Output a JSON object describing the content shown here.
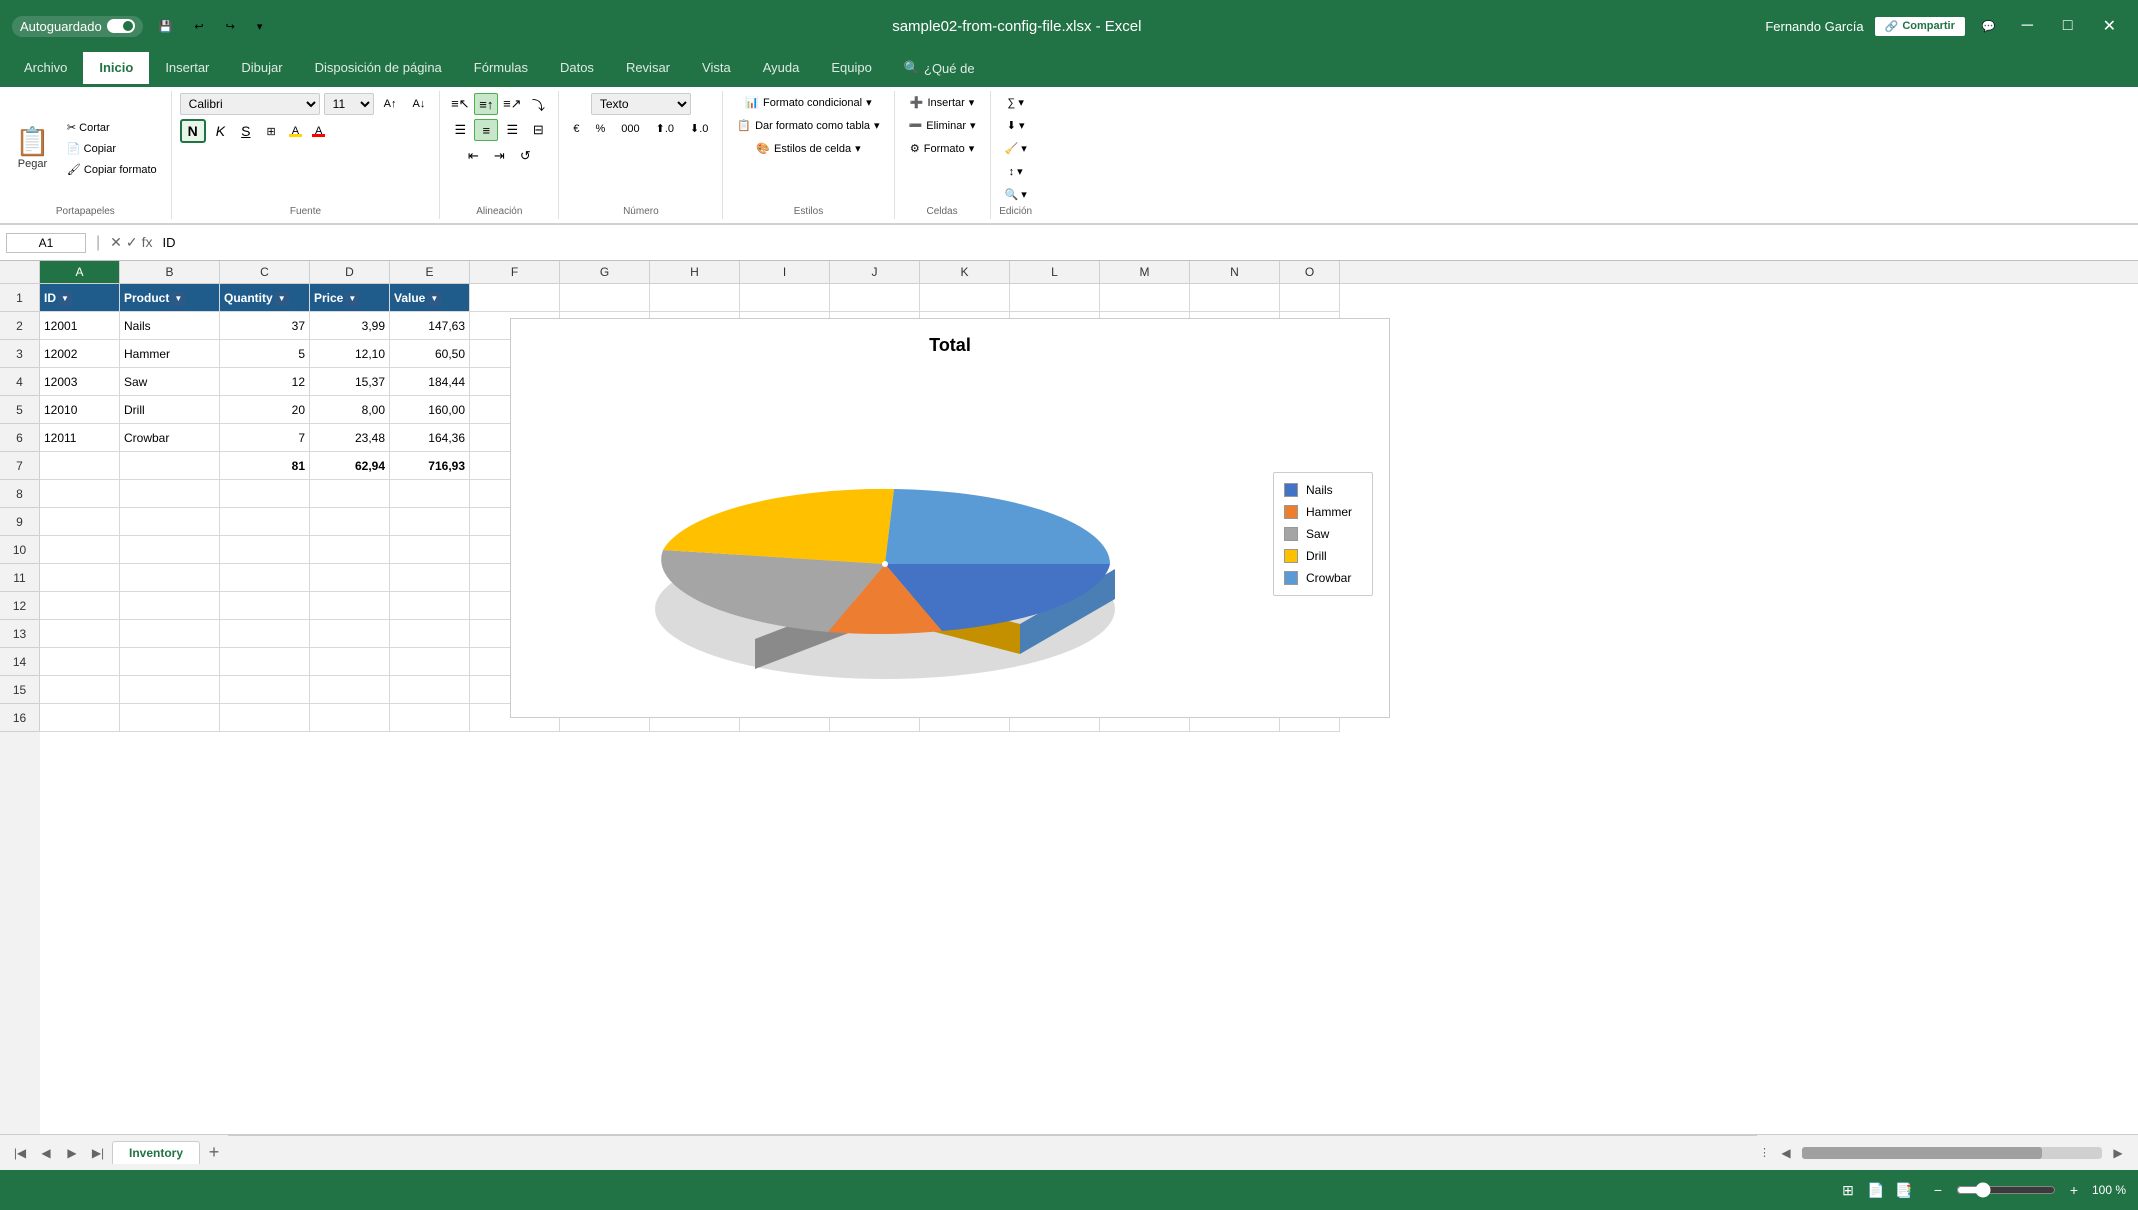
{
  "titlebar": {
    "autosave_label": "Autoguardado",
    "filename": "sample02-from-config-file.xlsx - Excel",
    "username": "Fernando García"
  },
  "ribbon": {
    "tabs": [
      "Archivo",
      "Inicio",
      "Insertar",
      "Dibujar",
      "Disposición de página",
      "Fórmulas",
      "Datos",
      "Revisar",
      "Vista",
      "Ayuda",
      "Equipo",
      "¿Qué de"
    ],
    "active_tab": "Inicio",
    "groups": {
      "portapapeles": "Portapapeles",
      "fuente": "Fuente",
      "alineacion": "Alineación",
      "numero": "Número",
      "estilos": "Estilos",
      "celdas": "Celdas",
      "edicion": "Edición"
    },
    "font": "Calibri",
    "font_size": "11",
    "number_format": "Texto",
    "pegar_label": "Pegar",
    "insertar_label": "Insertar",
    "eliminar_label": "Eliminar",
    "formato_label": "Formato",
    "formato_condicional": "Formato condicional",
    "formato_tabla": "Dar formato como tabla",
    "estilos_celda": "Estilos de celda",
    "compartir_label": "Compartir"
  },
  "formulabar": {
    "cell_ref": "A1",
    "formula": "ID"
  },
  "columns": [
    "A",
    "B",
    "C",
    "D",
    "E",
    "F",
    "G",
    "H",
    "I",
    "J",
    "K",
    "L",
    "M",
    "N",
    "O"
  ],
  "col_headers": {
    "A": "A",
    "B": "B",
    "C": "C",
    "D": "D",
    "E": "E",
    "F": "F",
    "G": "G",
    "H": "H",
    "I": "I",
    "J": "J",
    "K": "K",
    "L": "L",
    "M": "M",
    "N": "N",
    "O": "O"
  },
  "rows": [
    {
      "num": 1,
      "cells": {
        "A": "ID",
        "B": "Product",
        "C": "Quantity",
        "D": "Price",
        "E": "Value",
        "F": "",
        "G": "",
        "H": "",
        "I": "",
        "J": "",
        "K": "",
        "L": "",
        "M": "",
        "N": "",
        "O": ""
      }
    },
    {
      "num": 2,
      "cells": {
        "A": "12001",
        "B": "Nails",
        "C": "37",
        "D": "3,99",
        "E": "147,63",
        "F": "",
        "G": "",
        "H": "",
        "I": "",
        "J": "",
        "K": "",
        "L": "",
        "M": "",
        "N": "",
        "O": ""
      }
    },
    {
      "num": 3,
      "cells": {
        "A": "12002",
        "B": "Hammer",
        "C": "5",
        "D": "12,10",
        "E": "60,50",
        "F": "",
        "G": "",
        "H": "",
        "I": "",
        "J": "",
        "K": "",
        "L": "",
        "M": "",
        "N": "",
        "O": ""
      }
    },
    {
      "num": 4,
      "cells": {
        "A": "12003",
        "B": "Saw",
        "C": "12",
        "D": "15,37",
        "E": "184,44",
        "F": "",
        "G": "",
        "H": "",
        "I": "",
        "J": "",
        "K": "",
        "L": "",
        "M": "",
        "N": "",
        "O": ""
      }
    },
    {
      "num": 5,
      "cells": {
        "A": "12010",
        "B": "Drill",
        "C": "20",
        "D": "8,00",
        "E": "160,00",
        "F": "",
        "G": "",
        "H": "",
        "I": "",
        "J": "",
        "K": "",
        "L": "",
        "M": "",
        "N": "",
        "O": ""
      }
    },
    {
      "num": 6,
      "cells": {
        "A": "12011",
        "B": "Crowbar",
        "C": "7",
        "D": "23,48",
        "E": "164,36",
        "F": "",
        "G": "",
        "H": "",
        "I": "",
        "J": "",
        "K": "",
        "L": "",
        "M": "",
        "N": "",
        "O": ""
      }
    },
    {
      "num": 7,
      "cells": {
        "A": "",
        "B": "",
        "C": "81",
        "D": "62,94",
        "E": "716,93",
        "F": "",
        "G": "",
        "H": "",
        "I": "",
        "J": "",
        "K": "",
        "L": "",
        "M": "",
        "N": "",
        "O": ""
      }
    },
    {
      "num": 8,
      "cells": {}
    },
    {
      "num": 9,
      "cells": {}
    },
    {
      "num": 10,
      "cells": {}
    },
    {
      "num": 11,
      "cells": {}
    },
    {
      "num": 12,
      "cells": {}
    },
    {
      "num": 13,
      "cells": {}
    },
    {
      "num": 14,
      "cells": {}
    },
    {
      "num": 15,
      "cells": {}
    },
    {
      "num": 16,
      "cells": {}
    }
  ],
  "chart": {
    "title": "Total",
    "slices": [
      {
        "label": "Nails",
        "value": 147.63,
        "color": "#4472C4",
        "pct": 20.6
      },
      {
        "label": "Hammer",
        "value": 60.5,
        "color": "#ED7D31",
        "pct": 8.4
      },
      {
        "label": "Saw",
        "value": 184.44,
        "color": "#A5A5A5",
        "pct": 25.7
      },
      {
        "label": "Drill",
        "value": 160.0,
        "color": "#FFC000",
        "pct": 22.3
      },
      {
        "label": "Crowbar",
        "value": 164.36,
        "color": "#5B9BD5",
        "pct": 22.9
      }
    ]
  },
  "sheet_tabs": [
    "Inventory"
  ],
  "statusbar": {
    "zoom": "100 %",
    "zoom_value": 100
  }
}
